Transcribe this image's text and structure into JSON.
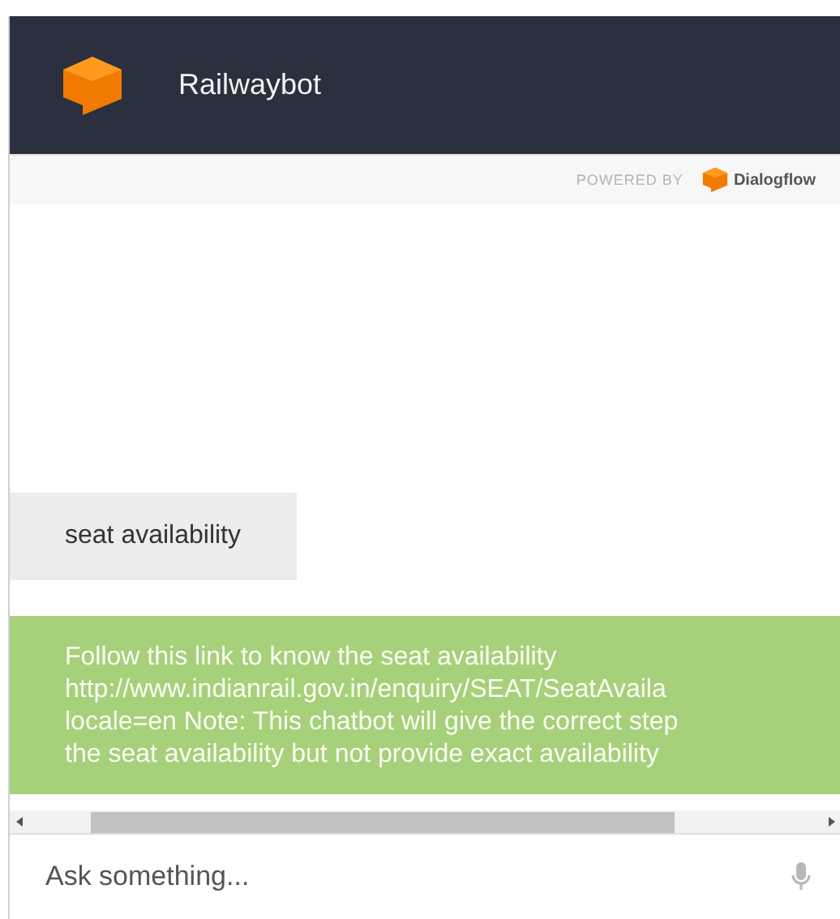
{
  "header": {
    "title": "Railwaybot"
  },
  "powered_bar": {
    "label": "POWERED BY",
    "brand": "Dialogflow"
  },
  "messages": [
    {
      "kind": "user",
      "lines": [
        "seat availability"
      ]
    },
    {
      "kind": "bot",
      "lines": [
        "Follow this link to know the seat availability",
        "http://www.indianrail.gov.in/enquiry/SEAT/SeatAvaila",
        "locale=en Note: This chatbot will give the correct step",
        "the seat availability but not provide exact availability"
      ]
    }
  ],
  "input": {
    "placeholder": "Ask something..."
  }
}
